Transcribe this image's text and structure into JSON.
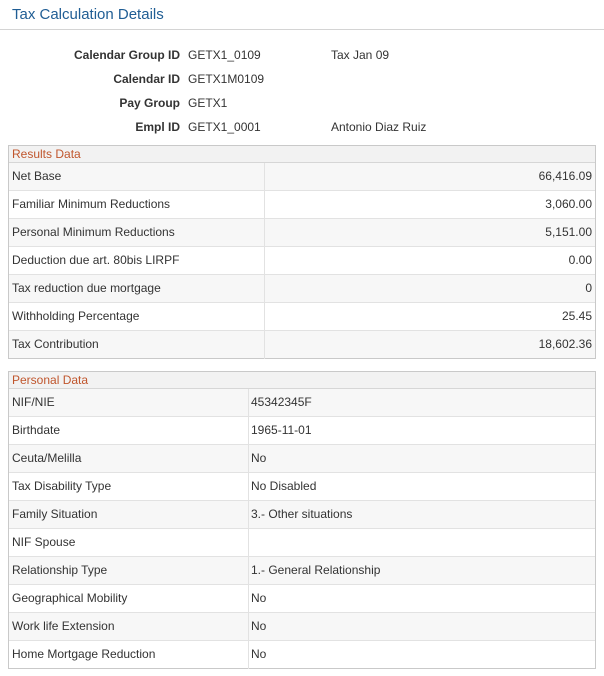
{
  "page": {
    "title": "Tax Calculation Details"
  },
  "header": {
    "fields": [
      {
        "label": "Calendar Group ID",
        "value": "GETX1_0109",
        "desc": "Tax Jan 09"
      },
      {
        "label": "Calendar ID",
        "value": "GETX1M0109",
        "desc": ""
      },
      {
        "label": "Pay Group",
        "value": "GETX1",
        "desc": ""
      },
      {
        "label": "Empl ID",
        "value": "GETX1_0001",
        "desc": "Antonio Diaz Ruiz"
      }
    ]
  },
  "results": {
    "title": "Results Data",
    "rows": [
      {
        "label": "Net Base",
        "value": "66,416.09"
      },
      {
        "label": "Familiar Minimum Reductions",
        "value": "3,060.00"
      },
      {
        "label": "Personal Minimum Reductions",
        "value": "5,151.00"
      },
      {
        "label": "Deduction due art. 80bis LIRPF",
        "value": "0.00"
      },
      {
        "label": "Tax reduction due mortgage",
        "value": "0"
      },
      {
        "label": "Withholding Percentage",
        "value": "25.45"
      },
      {
        "label": "Tax Contribution",
        "value": "18,602.36"
      }
    ]
  },
  "personal": {
    "title": "Personal Data",
    "rows": [
      {
        "label": "NIF/NIE",
        "value": "45342345F"
      },
      {
        "label": "Birthdate",
        "value": "1965-11-01"
      },
      {
        "label": "Ceuta/Melilla",
        "value": "No"
      },
      {
        "label": "Tax Disability Type",
        "value": "No Disabled"
      },
      {
        "label": "Family Situation",
        "value": "3.- Other situations"
      },
      {
        "label": "NIF Spouse",
        "value": ""
      },
      {
        "label": "Relationship Type",
        "value": "1.- General Relationship"
      },
      {
        "label": "Geographical Mobility",
        "value": "No"
      },
      {
        "label": "Work life Extension",
        "value": "No"
      },
      {
        "label": "Home Mortgage Reduction",
        "value": "No"
      }
    ]
  },
  "colors": {
    "title": "#1f5d94",
    "section_title": "#c0562d",
    "border": "#c9c9c9"
  }
}
